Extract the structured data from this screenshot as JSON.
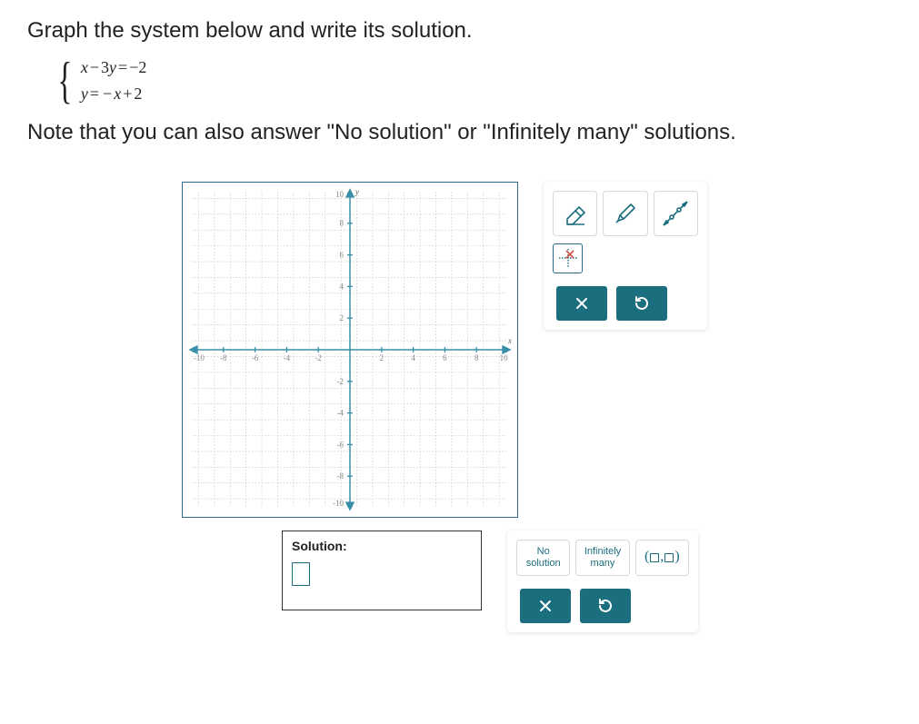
{
  "question": {
    "prompt": "Graph the system below and write its solution.",
    "eq1_lhs_var1": "x",
    "eq1_op1": "−",
    "eq1_coef": "3",
    "eq1_lhs_var2": "y",
    "eq1_eq": "=",
    "eq1_rhs": "−2",
    "eq2_lhs": "y",
    "eq2_eq": "=",
    "eq2_rhs_op": "−",
    "eq2_rhs_var": "x",
    "eq2_rhs_plus": "+",
    "eq2_rhs_const": "2",
    "note": "Note that you can also answer \"No solution\" or \"Infinitely many\" solutions."
  },
  "graph": {
    "x_label": "x",
    "y_label": "y",
    "ticks_pos": [
      "2",
      "4",
      "6",
      "8",
      "10"
    ],
    "ticks_neg": [
      "-2",
      "-4",
      "-6",
      "-8",
      "-10"
    ]
  },
  "tools": {
    "eraser": "eraser-icon",
    "pencil": "pencil-icon",
    "line": "line-icon",
    "remove_point": "remove-point-icon",
    "clear": "clear-icon",
    "reset": "reset-icon"
  },
  "solution": {
    "label": "Solution:",
    "value": ""
  },
  "answer_options": {
    "no_solution_l1": "No",
    "no_solution_l2": "solution",
    "inf_l1": "Infinitely",
    "inf_l2": "many",
    "ord_open": "(",
    "ord_comma": ",",
    "ord_close": ")"
  }
}
